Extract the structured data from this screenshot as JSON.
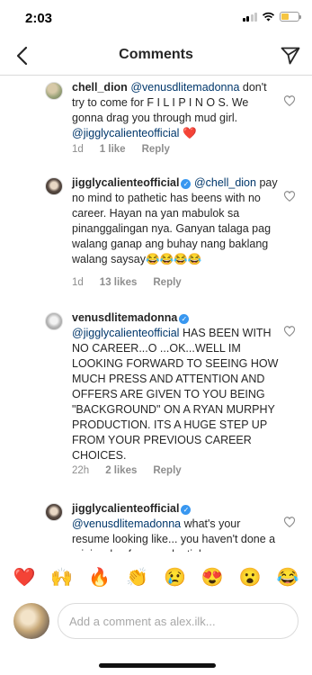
{
  "status_bar": {
    "time": "2:03",
    "battery_level": 0.45,
    "battery_color": "#f5c542"
  },
  "header": {
    "title": "Comments",
    "back_icon": "chevron-left-icon",
    "send_icon": "paper-plane-icon"
  },
  "comments": [
    {
      "username": "chell_dion",
      "verified": false,
      "mention": "@venusdlitemadonna",
      "text": "don't try to come for F I L I P I N O S. We gonna drag you through mud girl.",
      "mention2": "@jigglycalienteofficial",
      "emoji": "❤️",
      "time": "1d",
      "likes": "1 like",
      "reply": "Reply"
    },
    {
      "username": "jigglycalienteofficial",
      "verified": true,
      "mention": "@chell_dion",
      "text": "pay no mind to pathetic has beens with no career.  Hayan na yan mabulok sa pinanggalingan nya. Ganyan talaga pag walang ganap ang buhay nang baklang walang saysay😂😂😂😂",
      "time": "1d",
      "likes": "13 likes",
      "reply": "Reply"
    },
    {
      "username": "venusdlitemadonna",
      "verified": true,
      "mention": "@jigglycalienteofficial",
      "text": "HAS BEEN WITH NO CAREER...O ...OK...WELL IM LOOKING FORWARD TO SEEING HOW MUCH PRESS AND ATTENTION AND OFFERS ARE GIVEN TO YOU BEING \"BACKGROUND\" ON A RYAN MURPHY PRODUCTION. ITS A HUGE STEP UP FROM YOUR PREVIOUS CAREER CHOICES.",
      "time": "22h",
      "likes": "2 likes",
      "reply": "Reply"
    },
    {
      "username": "jigglycalienteofficial",
      "verified": true,
      "mention": "@venusdlitemadonna",
      "text": "what's your resume looking like... you haven't done a miniscule of my credentials."
    }
  ],
  "reactions": [
    "❤️",
    "🙌",
    "🔥",
    "👏",
    "😢",
    "😍",
    "😮",
    "😂"
  ],
  "composer": {
    "placeholder": "Add a comment as alex.ilk..."
  }
}
